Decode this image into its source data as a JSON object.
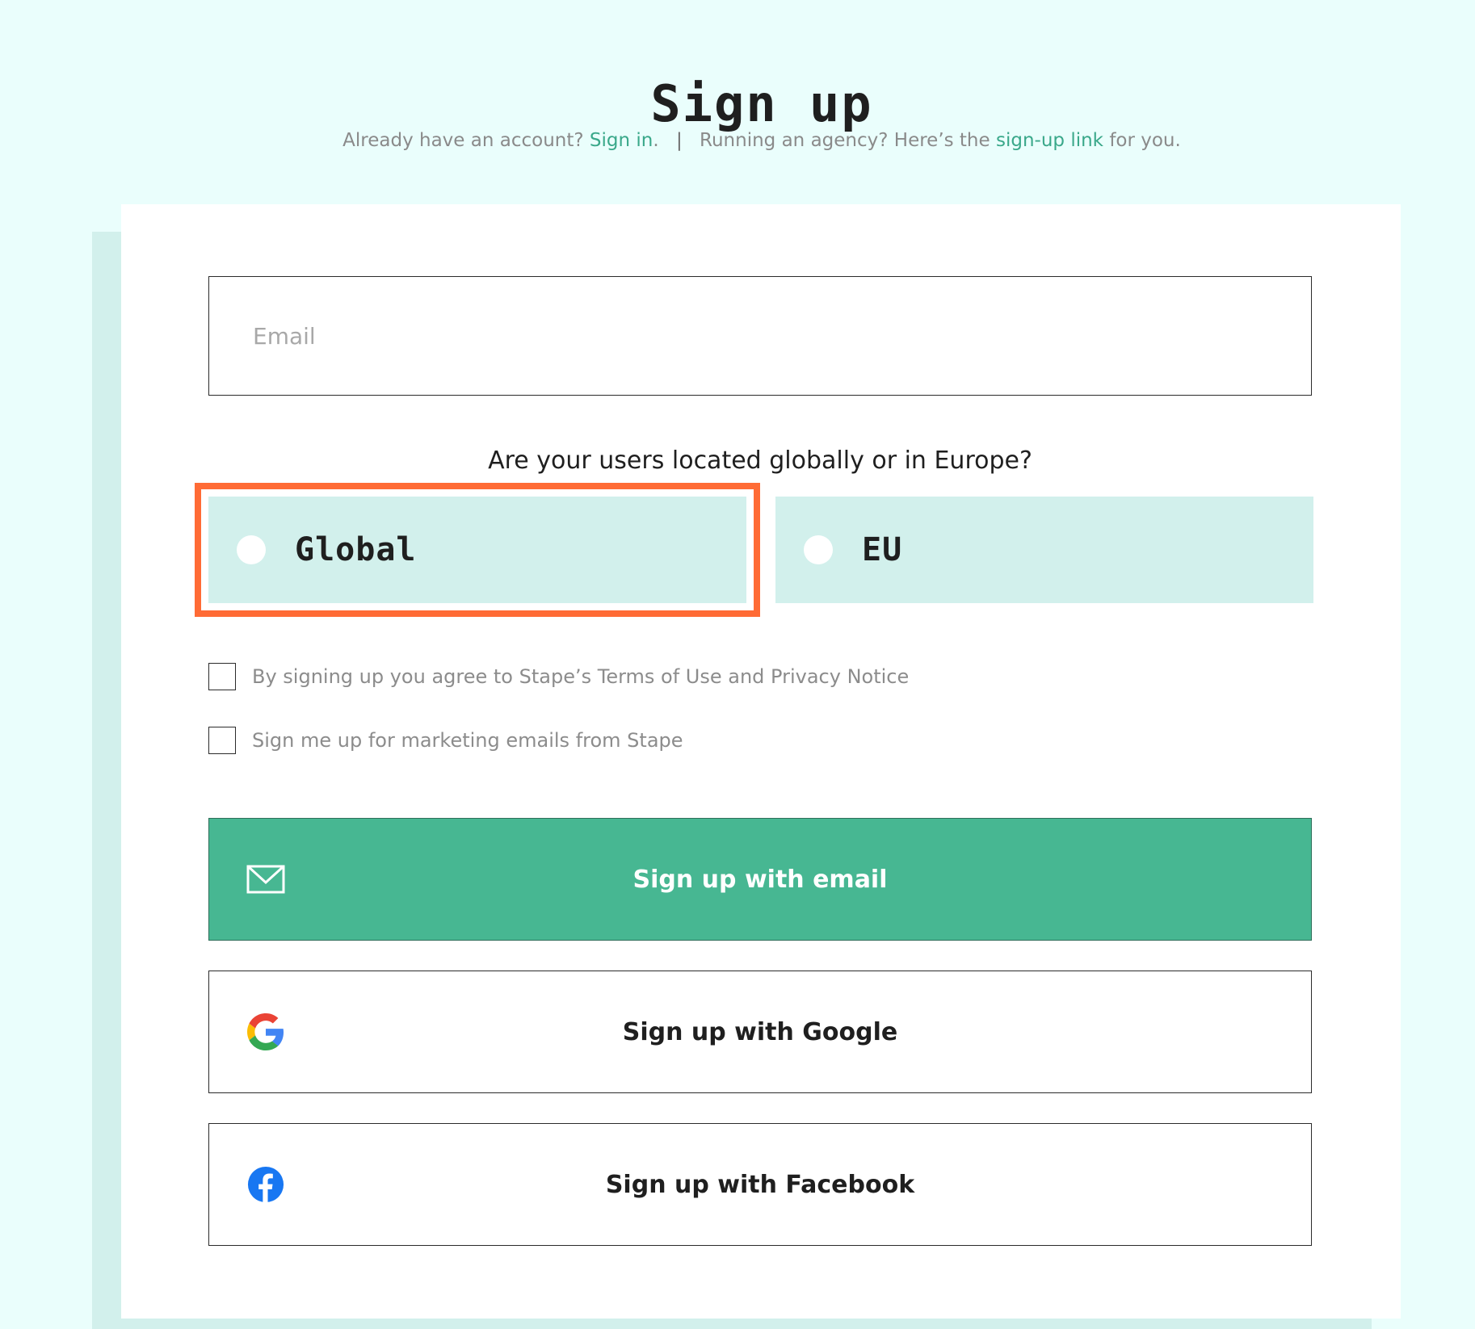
{
  "header": {
    "title": "Sign up",
    "already_text": "Already have an account?",
    "sign_in_link": "Sign in",
    "sign_in_suffix": ".",
    "separator": "|",
    "agency_text": "Running an agency? Here’s the",
    "agency_link": "sign-up link",
    "agency_suffix": "for you."
  },
  "form": {
    "email_placeholder": "Email",
    "region_question": "Are your users located globally or in Europe?",
    "regions": [
      {
        "label": "Global",
        "highlighted": true
      },
      {
        "label": "EU",
        "highlighted": false
      }
    ],
    "checkboxes": [
      {
        "label": "By signing up you agree to Stape’s Terms of Use and Privacy Notice",
        "checked": false
      },
      {
        "label": "Sign me up for marketing emails from Stape",
        "checked": false
      }
    ]
  },
  "buttons": {
    "email": {
      "label": "Sign up with email",
      "icon": "envelope-icon"
    },
    "google": {
      "label": "Sign up with Google",
      "icon": "google-icon"
    },
    "facebook": {
      "label": "Sign up with Facebook",
      "icon": "facebook-icon"
    }
  },
  "colors": {
    "background": "#eafefc",
    "accent_green": "#47b792",
    "link_green": "#3aa88a",
    "option_bg": "#d2f0ec",
    "highlight_orange": "#ff6b35",
    "facebook_blue": "#1877f2"
  }
}
